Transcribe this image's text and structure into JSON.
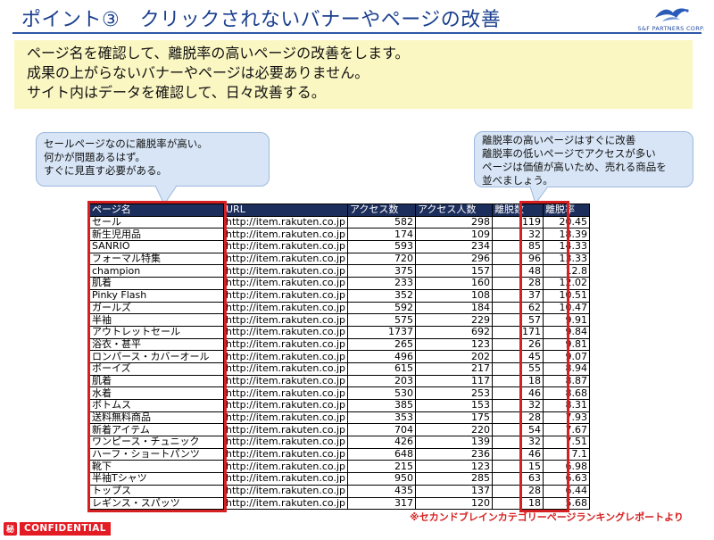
{
  "slide": {
    "title": "ポイント③　クリックされないバナーやページの改善",
    "logo_text": "S&F PARTNERS CORP."
  },
  "summary": {
    "lines": [
      "ページ名を確認して、離脱率の高いページの改善をします。",
      "成果の上がらないバナーやページは必要ありません。",
      "サイト内はデータを確認して、日々改善する。"
    ]
  },
  "callouts": {
    "left": [
      "セールページなのに離脱率が高い。",
      "何かが問題あるはず。",
      "すぐに見直す必要がある。"
    ],
    "right": [
      "離脱率の高いページはすぐに改善",
      "離脱率の低いページでアクセスが多い",
      "ページは価値が高いため、売れる商品を",
      "並べましょう。"
    ]
  },
  "table": {
    "headers": [
      "ページ名",
      "URL",
      "アクセス数",
      "アクセス人数",
      "離脱数",
      "離脱率"
    ],
    "rows": [
      [
        "セール",
        "http://item.rakuten.co.jp",
        "582",
        "298",
        "119",
        "20.45"
      ],
      [
        "新生児用品",
        "http://item.rakuten.co.jp",
        "174",
        "109",
        "32",
        "18.39"
      ],
      [
        "SANRIO",
        "http://item.rakuten.co.jp",
        "593",
        "234",
        "85",
        "14.33"
      ],
      [
        "フォーマル特集",
        "http://item.rakuten.co.jp",
        "720",
        "296",
        "96",
        "13.33"
      ],
      [
        "champion",
        "http://item.rakuten.co.jp",
        "375",
        "157",
        "48",
        "12.8"
      ],
      [
        "肌着",
        "http://item.rakuten.co.jp",
        "233",
        "160",
        "28",
        "12.02"
      ],
      [
        "Pinky Flash",
        "http://item.rakuten.co.jp",
        "352",
        "108",
        "37",
        "10.51"
      ],
      [
        "ガールズ",
        "http://item.rakuten.co.jp",
        "592",
        "184",
        "62",
        "10.47"
      ],
      [
        "半袖",
        "http://item.rakuten.co.jp",
        "575",
        "229",
        "57",
        "9.91"
      ],
      [
        "アウトレットセール",
        "http://item.rakuten.co.jp",
        "1737",
        "692",
        "171",
        "9.84"
      ],
      [
        "浴衣・甚平",
        "http://item.rakuten.co.jp",
        "265",
        "123",
        "26",
        "9.81"
      ],
      [
        "ロンパース・カバーオール",
        "http://item.rakuten.co.jp",
        "496",
        "202",
        "45",
        "9.07"
      ],
      [
        "ボーイズ",
        "http://item.rakuten.co.jp",
        "615",
        "217",
        "55",
        "8.94"
      ],
      [
        "肌着",
        "http://item.rakuten.co.jp",
        "203",
        "117",
        "18",
        "8.87"
      ],
      [
        "水着",
        "http://item.rakuten.co.jp",
        "530",
        "253",
        "46",
        "8.68"
      ],
      [
        "ボトムス",
        "http://item.rakuten.co.jp",
        "385",
        "153",
        "32",
        "8.31"
      ],
      [
        "送料無料商品",
        "http://item.rakuten.co.jp",
        "353",
        "175",
        "28",
        "7.93"
      ],
      [
        "新着アイテム",
        "http://item.rakuten.co.jp",
        "704",
        "220",
        "54",
        "7.67"
      ],
      [
        "ワンピース・チュニック",
        "http://item.rakuten.co.jp",
        "426",
        "139",
        "32",
        "7.51"
      ],
      [
        "ハーフ・ショートパンツ",
        "http://item.rakuten.co.jp",
        "648",
        "236",
        "46",
        "7.1"
      ],
      [
        "靴下",
        "http://item.rakuten.co.jp",
        "215",
        "123",
        "15",
        "6.98"
      ],
      [
        "半袖Tシャツ",
        "http://item.rakuten.co.jp",
        "950",
        "285",
        "63",
        "6.63"
      ],
      [
        "トップス",
        "http://item.rakuten.co.jp",
        "435",
        "137",
        "28",
        "6.44"
      ],
      [
        "レギンス・スパッツ",
        "http://item.rakuten.co.jp",
        "317",
        "120",
        "18",
        "5.68"
      ]
    ]
  },
  "source_note": "※セカンドブレインカテゴリーページランキングレポートより",
  "footer": {
    "confidential_mark": "秘",
    "confidential_text": "CONFIDENTIAL"
  },
  "colors": {
    "title": "#1a3f8e",
    "highlight": "#d42020",
    "header_bg": "#1c2e5c",
    "summary_bg": "#fbf7c3",
    "callout_bg": "#d7e5f6"
  }
}
